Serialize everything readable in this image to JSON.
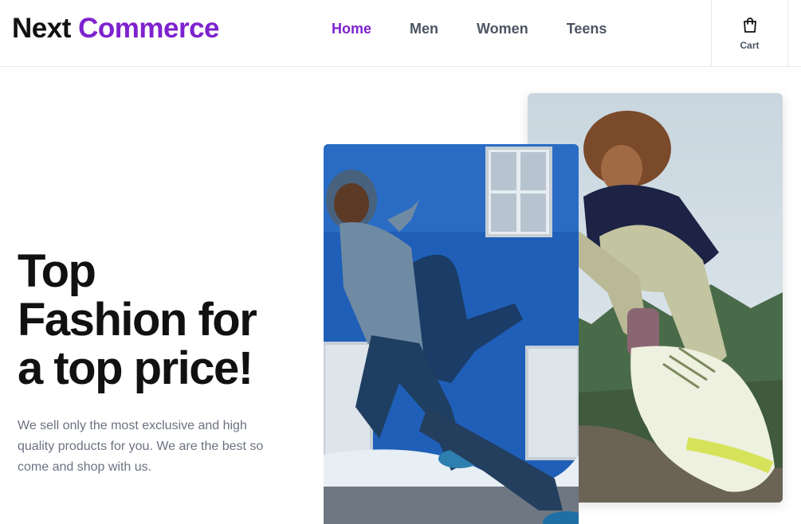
{
  "brand": {
    "name_part1": "Next",
    "name_part2": "Commerce"
  },
  "colors": {
    "accent": "#7e22ce",
    "nav_text": "#4b5563",
    "body_text": "#6b7280"
  },
  "nav": {
    "items": [
      {
        "label": "Home",
        "active": true
      },
      {
        "label": "Men",
        "active": false
      },
      {
        "label": "Women",
        "active": false
      },
      {
        "label": "Teens",
        "active": false
      }
    ]
  },
  "cart": {
    "label": "Cart",
    "icon": "shopping-bag-icon"
  },
  "hero": {
    "headline_line1": "Top",
    "headline_line2": "Fashion for",
    "headline_line3": "a top price!",
    "description": "We sell only the most exclusive and high quality products for you. We are the best so come and shop with us."
  }
}
